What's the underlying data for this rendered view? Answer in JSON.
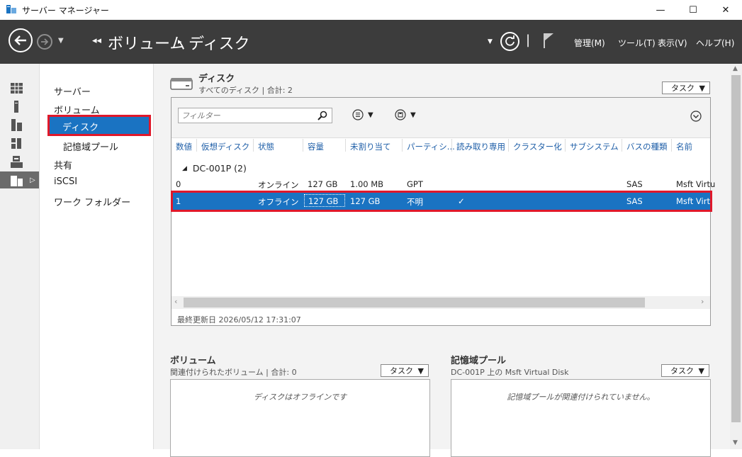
{
  "window": {
    "title": "サーバー マネージャー",
    "minimize": "—",
    "maximize": "☐",
    "close": "✕"
  },
  "header": {
    "breadcrumb_root": "ボリューム",
    "breadcrumb_current": "ディスク",
    "menu": [
      "管理(M)",
      "ツール(T)",
      "表示(V)",
      "ヘルプ(H)"
    ]
  },
  "nav": {
    "items": [
      "サーバー",
      "ボリューム",
      "ディスク",
      "記憶域プール",
      "共有",
      "iSCSI",
      "ワーク フォルダー"
    ],
    "selected": "ディスク"
  },
  "disks": {
    "title": "ディスク",
    "subtitle": "すべてのディスク | 合計: 2",
    "task_label": "タスク",
    "filter_placeholder": "フィルター",
    "columns": [
      "数値",
      "仮想ディスク",
      "状態",
      "容量",
      "未割り当て",
      "パーティシ...",
      "読み取り専用",
      "クラスター化",
      "サブシステム",
      "バスの種類",
      "名前"
    ],
    "group_label": "DC-001P (2)",
    "rows": [
      {
        "number": "0",
        "status": "オンライン",
        "capacity": "127 GB",
        "unallocated": "1.00 MB",
        "partition": "GPT",
        "readonly": "",
        "bus": "SAS",
        "name": "Msft Virtu"
      },
      {
        "number": "1",
        "status": "オフライン",
        "capacity": "127 GB",
        "unallocated": "127 GB",
        "partition": "不明",
        "readonly": "✓",
        "bus": "SAS",
        "name": "Msft Virt"
      }
    ],
    "last_updated": "最終更新日 2026/05/12 17:31:07"
  },
  "volumes": {
    "title": "ボリューム",
    "subtitle": "関連付けられたボリューム | 合計: 0",
    "task_label": "タスク",
    "empty_text": "ディスクはオフラインです"
  },
  "pools": {
    "title": "記憶域プール",
    "subtitle": "DC-001P 上の Msft Virtual Disk",
    "task_label": "タスク",
    "empty_text": "記憶域プールが関連付けられていません。"
  },
  "colors": {
    "accent": "#1a73c2",
    "highlight": "#e0182a",
    "header_bg": "#3c3c3c"
  }
}
